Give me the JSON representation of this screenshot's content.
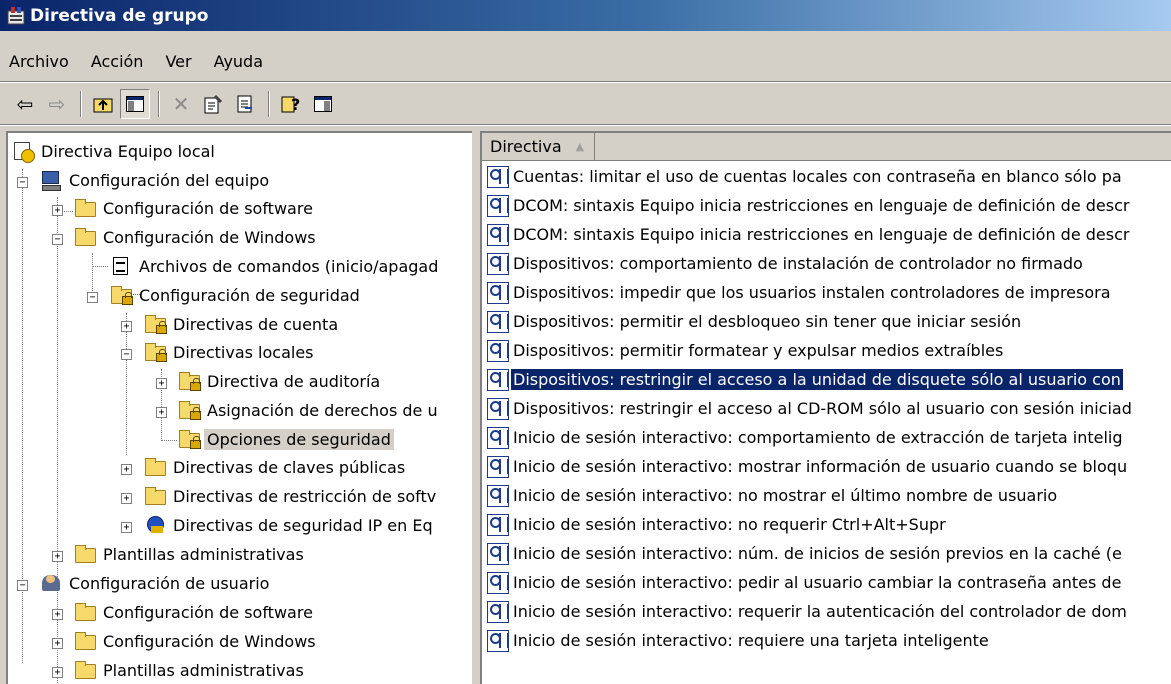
{
  "window": {
    "title": "Directiva de grupo"
  },
  "menu": [
    "Archivo",
    "Acción",
    "Ver",
    "Ayuda"
  ],
  "toolbar": {
    "buttons": [
      "back-arrow-icon",
      "forward-arrow-icon",
      "up-folder-icon",
      "show-hide-tree-icon",
      "delete-icon",
      "properties-icon",
      "export-list-icon",
      "help-icon",
      "show-hide-action-pane-icon"
    ]
  },
  "tree": {
    "items": [
      {
        "label": "Directiva Equipo local"
      },
      {
        "label": "Configuración del equipo"
      },
      {
        "label": "Configuración de software"
      },
      {
        "label": "Configuración de Windows"
      },
      {
        "label": "Archivos de comandos (inicio/apagad"
      },
      {
        "label": "Configuración de seguridad"
      },
      {
        "label": "Directivas de cuenta"
      },
      {
        "label": "Directivas locales"
      },
      {
        "label": "Directiva de auditoría"
      },
      {
        "label": "Asignación de derechos de u"
      },
      {
        "label": "Opciones de seguridad"
      },
      {
        "label": "Directivas de claves públicas"
      },
      {
        "label": "Directivas de restricción de softv"
      },
      {
        "label": "Directivas de seguridad IP en Eq"
      },
      {
        "label": "Plantillas administrativas"
      },
      {
        "label": "Configuración de usuario"
      },
      {
        "label": "Configuración de software"
      },
      {
        "label": "Configuración de Windows"
      },
      {
        "label": "Plantillas administrativas"
      }
    ]
  },
  "list": {
    "column": "Directiva",
    "rows": [
      "Cuentas: limitar el uso de cuentas locales con contraseña en blanco sólo pa",
      "DCOM: sintaxis Equipo inicia restricciones en lenguaje de definición de descr",
      "DCOM: sintaxis Equipo inicia restricciones en lenguaje de definición de descr",
      "Dispositivos: comportamiento de instalación de controlador no firmado",
      "Dispositivos: impedir que los usuarios instalen controladores de impresora",
      "Dispositivos: permitir el desbloqueo sin tener que iniciar sesión",
      "Dispositivos: permitir formatear y expulsar medios extraíbles",
      "Dispositivos: restringir el acceso a la unidad de disquete sólo al usuario con",
      "Dispositivos: restringir el acceso al CD-ROM sólo al usuario con sesión iniciad",
      "Inicio de sesión interactivo: comportamiento de extracción de tarjeta intelig",
      "Inicio de sesión interactivo: mostrar información de usuario cuando se bloqu",
      "Inicio de sesión interactivo: no mostrar el último nombre de usuario",
      "Inicio de sesión interactivo: no requerir Ctrl+Alt+Supr",
      "Inicio de sesión interactivo: núm. de inicios de sesión previos en la caché (e",
      "Inicio de sesión interactivo: pedir al usuario cambiar la contraseña antes de",
      "Inicio de sesión interactivo: requerir la autenticación del controlador de dom",
      "Inicio de sesión interactivo: requiere una tarjeta inteligente"
    ]
  },
  "colors": {
    "title_start": "#0a246a",
    "title_end": "#a6caf0",
    "selection": "#0a246a",
    "chrome": "#d4d0c8"
  }
}
